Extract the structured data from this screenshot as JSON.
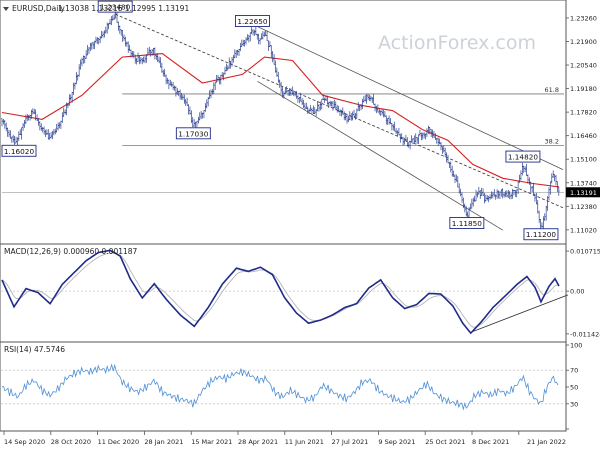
{
  "chart_data": [
    {
      "type": "candlestick",
      "title": "EURUSD,Daily",
      "ohlc_readout": "1.13038 1.13216 1.12995 1.13191",
      "watermark": "ActionForex.com",
      "y_ticks": [
        "1.23260",
        "1.21900",
        "1.20540",
        "1.19180",
        "1.17820",
        "1.16460",
        "1.15100",
        "1.13740",
        "1.12380",
        "1.11020"
      ],
      "y_tick_values": [
        1.2326,
        1.219,
        1.2054,
        1.1918,
        1.1782,
        1.1646,
        1.151,
        1.1374,
        1.1238,
        1.1102
      ],
      "ylim": [
        1.1055,
        1.2395
      ],
      "x_ticks": [
        "14 Sep 2020",
        "28 Oct 2020",
        "11 Dec 2020",
        "28 Jan 2021",
        "15 Mar 2021",
        "28 Apr 2021",
        "11 Jun 2021",
        "27 Jul 2021",
        "9 Sep 2021",
        "25 Oct 2021",
        "8 Dec 2021",
        "21 Jan 2022"
      ],
      "current_price": "1.13191",
      "current_price_value": 1.13191,
      "price_path": [
        {
          "d": 0,
          "p": 1.1745
        },
        {
          "d": 8,
          "p": 1.165
        },
        {
          "d": 14,
          "p": 1.1602
        },
        {
          "d": 22,
          "p": 1.172
        },
        {
          "d": 30,
          "p": 1.179
        },
        {
          "d": 38,
          "p": 1.17
        },
        {
          "d": 46,
          "p": 1.164
        },
        {
          "d": 54,
          "p": 1.168
        },
        {
          "d": 62,
          "p": 1.178
        },
        {
          "d": 70,
          "p": 1.19
        },
        {
          "d": 78,
          "p": 1.205
        },
        {
          "d": 86,
          "p": 1.215
        },
        {
          "d": 94,
          "p": 1.22
        },
        {
          "d": 102,
          "p": 1.225
        },
        {
          "d": 108,
          "p": 1.23
        },
        {
          "d": 113,
          "p": 1.2348
        },
        {
          "d": 118,
          "p": 1.225
        },
        {
          "d": 126,
          "p": 1.215
        },
        {
          "d": 134,
          "p": 1.209
        },
        {
          "d": 142,
          "p": 1.208
        },
        {
          "d": 150,
          "p": 1.215
        },
        {
          "d": 156,
          "p": 1.208
        },
        {
          "d": 164,
          "p": 1.196
        },
        {
          "d": 172,
          "p": 1.192
        },
        {
          "d": 180,
          "p": 1.186
        },
        {
          "d": 186,
          "p": 1.18
        },
        {
          "d": 191,
          "p": 1.1703
        },
        {
          "d": 198,
          "p": 1.176
        },
        {
          "d": 205,
          "p": 1.184
        },
        {
          "d": 213,
          "p": 1.195
        },
        {
          "d": 221,
          "p": 1.201
        },
        {
          "d": 229,
          "p": 1.208
        },
        {
          "d": 237,
          "p": 1.215
        },
        {
          "d": 244,
          "p": 1.22
        },
        {
          "d": 250,
          "p": 1.2265
        },
        {
          "d": 256,
          "p": 1.22
        },
        {
          "d": 262,
          "p": 1.223
        },
        {
          "d": 268,
          "p": 1.215
        },
        {
          "d": 274,
          "p": 1.2
        },
        {
          "d": 280,
          "p": 1.188
        },
        {
          "d": 288,
          "p": 1.19
        },
        {
          "d": 296,
          "p": 1.186
        },
        {
          "d": 304,
          "p": 1.18
        },
        {
          "d": 312,
          "p": 1.178
        },
        {
          "d": 320,
          "p": 1.185
        },
        {
          "d": 328,
          "p": 1.183
        },
        {
          "d": 336,
          "p": 1.179
        },
        {
          "d": 344,
          "p": 1.174
        },
        {
          "d": 352,
          "p": 1.177
        },
        {
          "d": 360,
          "p": 1.184
        },
        {
          "d": 366,
          "p": 1.188
        },
        {
          "d": 372,
          "p": 1.182
        },
        {
          "d": 380,
          "p": 1.176
        },
        {
          "d": 388,
          "p": 1.172
        },
        {
          "d": 396,
          "p": 1.164
        },
        {
          "d": 404,
          "p": 1.16
        },
        {
          "d": 412,
          "p": 1.162
        },
        {
          "d": 420,
          "p": 1.166
        },
        {
          "d": 426,
          "p": 1.168
        },
        {
          "d": 434,
          "p": 1.162
        },
        {
          "d": 440,
          "p": 1.156
        },
        {
          "d": 446,
          "p": 1.148
        },
        {
          "d": 452,
          "p": 1.14
        },
        {
          "d": 458,
          "p": 1.13
        },
        {
          "d": 464,
          "p": 1.1185
        },
        {
          "d": 470,
          "p": 1.126
        },
        {
          "d": 476,
          "p": 1.132
        },
        {
          "d": 482,
          "p": 1.128
        },
        {
          "d": 490,
          "p": 1.13
        },
        {
          "d": 498,
          "p": 1.132
        },
        {
          "d": 506,
          "p": 1.13
        },
        {
          "d": 514,
          "p": 1.134
        },
        {
          "d": 520,
          "p": 1.1482
        },
        {
          "d": 526,
          "p": 1.138
        },
        {
          "d": 532,
          "p": 1.13
        },
        {
          "d": 538,
          "p": 1.112
        },
        {
          "d": 542,
          "p": 1.118
        },
        {
          "d": 546,
          "p": 1.134
        },
        {
          "d": 550,
          "p": 1.142
        },
        {
          "d": 553,
          "p": 1.138
        },
        {
          "d": 556,
          "p": 1.1319
        }
      ],
      "moving_average_path": [
        {
          "d": 0,
          "p": 1.178
        },
        {
          "d": 40,
          "p": 1.174
        },
        {
          "d": 80,
          "p": 1.188
        },
        {
          "d": 120,
          "p": 1.21
        },
        {
          "d": 160,
          "p": 1.212
        },
        {
          "d": 200,
          "p": 1.195
        },
        {
          "d": 240,
          "p": 1.2
        },
        {
          "d": 262,
          "p": 1.21
        },
        {
          "d": 290,
          "p": 1.208
        },
        {
          "d": 320,
          "p": 1.188
        },
        {
          "d": 360,
          "p": 1.182
        },
        {
          "d": 390,
          "p": 1.179
        },
        {
          "d": 420,
          "p": 1.168
        },
        {
          "d": 445,
          "p": 1.162
        },
        {
          "d": 470,
          "p": 1.148
        },
        {
          "d": 500,
          "p": 1.14
        },
        {
          "d": 530,
          "p": 1.137
        },
        {
          "d": 556,
          "p": 1.135
        }
      ],
      "horizontal_lines": [
        {
          "label": "61.8",
          "price": 1.1887,
          "x_start_d": 120
        },
        {
          "label": "38.2",
          "price": 1.159,
          "x_start_d": 120
        },
        {
          "label": "",
          "price": 1.13191,
          "x_start_d": 0
        }
      ],
      "trend_lines": [
        {
          "name": "channel-upper",
          "from": {
            "d": 248,
            "p": 1.2295
          },
          "to": {
            "d": 560,
            "p": 1.145
          }
        },
        {
          "name": "channel-lower",
          "from": {
            "d": 255,
            "p": 1.196
          },
          "to": {
            "d": 500,
            "p": 1.11
          }
        },
        {
          "name": "channel-mid-dashed",
          "from": {
            "d": 113,
            "p": 1.2348
          },
          "to": {
            "d": 560,
            "p": 1.123
          }
        }
      ],
      "annotations": [
        {
          "label": "1.16020",
          "d": 14,
          "p": 1.1602,
          "anchor": "below"
        },
        {
          "label": "1.23480",
          "d": 113,
          "p": 1.2348,
          "anchor": "above"
        },
        {
          "label": "1.17030",
          "d": 191,
          "p": 1.1703,
          "anchor": "below"
        },
        {
          "label": "1.22650",
          "d": 250,
          "p": 1.2265,
          "anchor": "above"
        },
        {
          "label": "1.11850",
          "d": 464,
          "p": 1.1185,
          "anchor": "below"
        },
        {
          "label": "1.14820",
          "d": 520,
          "p": 1.1482,
          "anchor": "above"
        },
        {
          "label": "1.11200",
          "d": 538,
          "p": 1.112,
          "anchor": "below"
        }
      ]
    },
    {
      "type": "line",
      "title": "MACD(12,26,9) 0.000960 0.001187",
      "y_ticks": [
        "0.010715",
        "0.00",
        "-0.011424"
      ],
      "y_tick_values": [
        0.010715,
        0.0,
        -0.011424
      ],
      "ylim": [
        -0.0128,
        0.0118
      ],
      "series": [
        {
          "values": [
            {
              "d": 0,
              "v": 0.003
            },
            {
              "d": 12,
              "v": -0.004
            },
            {
              "d": 24,
              "v": 0.001
            },
            {
              "d": 36,
              "v": 0.0
            },
            {
              "d": 48,
              "v": -0.003
            },
            {
              "d": 60,
              "v": 0.002
            },
            {
              "d": 72,
              "v": 0.005
            },
            {
              "d": 84,
              "v": 0.008
            },
            {
              "d": 96,
              "v": 0.01
            },
            {
              "d": 108,
              "v": 0.0105
            },
            {
              "d": 118,
              "v": 0.009
            },
            {
              "d": 128,
              "v": 0.003
            },
            {
              "d": 140,
              "v": -0.002
            },
            {
              "d": 152,
              "v": 0.002
            },
            {
              "d": 164,
              "v": -0.002
            },
            {
              "d": 178,
              "v": -0.006
            },
            {
              "d": 192,
              "v": -0.009
            },
            {
              "d": 206,
              "v": -0.004
            },
            {
              "d": 220,
              "v": 0.002
            },
            {
              "d": 234,
              "v": 0.006
            },
            {
              "d": 246,
              "v": 0.005
            },
            {
              "d": 258,
              "v": 0.006
            },
            {
              "d": 270,
              "v": 0.004
            },
            {
              "d": 282,
              "v": -0.002
            },
            {
              "d": 294,
              "v": -0.006
            },
            {
              "d": 306,
              "v": -0.0085
            },
            {
              "d": 318,
              "v": -0.0075
            },
            {
              "d": 330,
              "v": -0.006
            },
            {
              "d": 342,
              "v": -0.004
            },
            {
              "d": 354,
              "v": -0.003
            },
            {
              "d": 366,
              "v": 0.001
            },
            {
              "d": 378,
              "v": 0.003
            },
            {
              "d": 390,
              "v": -0.002
            },
            {
              "d": 402,
              "v": -0.005
            },
            {
              "d": 414,
              "v": -0.004
            },
            {
              "d": 426,
              "v": -0.001
            },
            {
              "d": 438,
              "v": -0.001
            },
            {
              "d": 450,
              "v": -0.004
            },
            {
              "d": 460,
              "v": -0.0085
            },
            {
              "d": 468,
              "v": -0.011
            },
            {
              "d": 478,
              "v": -0.008
            },
            {
              "d": 490,
              "v": -0.004
            },
            {
              "d": 502,
              "v": -0.001
            },
            {
              "d": 514,
              "v": 0.002
            },
            {
              "d": 524,
              "v": 0.004
            },
            {
              "d": 532,
              "v": 0.001
            },
            {
              "d": 538,
              "v": -0.003
            },
            {
              "d": 546,
              "v": 0.001
            },
            {
              "d": 552,
              "v": 0.003
            },
            {
              "d": 556,
              "v": 0.001
            }
          ]
        }
      ],
      "trend_lines": [
        {
          "name": "macd-support-line",
          "from": {
            "d": 470,
            "v": -0.0108
          },
          "to": {
            "d": 565,
            "v": -0.001
          }
        }
      ]
    },
    {
      "type": "line",
      "title": "RSI(14) 47.5746",
      "y_ticks": [
        "100",
        "70",
        "50",
        "30",
        "0"
      ],
      "y_tick_values": [
        100,
        70,
        50,
        30,
        0
      ],
      "ylim": [
        0,
        100
      ],
      "series": [
        {
          "values": [
            {
              "d": 0,
              "v": 50
            },
            {
              "d": 8,
              "v": 44
            },
            {
              "d": 16,
              "v": 38
            },
            {
              "d": 24,
              "v": 52
            },
            {
              "d": 32,
              "v": 58
            },
            {
              "d": 40,
              "v": 46
            },
            {
              "d": 48,
              "v": 40
            },
            {
              "d": 56,
              "v": 48
            },
            {
              "d": 64,
              "v": 60
            },
            {
              "d": 72,
              "v": 66
            },
            {
              "d": 80,
              "v": 70
            },
            {
              "d": 88,
              "v": 68
            },
            {
              "d": 96,
              "v": 72
            },
            {
              "d": 104,
              "v": 70
            },
            {
              "d": 112,
              "v": 74
            },
            {
              "d": 120,
              "v": 56
            },
            {
              "d": 128,
              "v": 48
            },
            {
              "d": 136,
              "v": 44
            },
            {
              "d": 144,
              "v": 50
            },
            {
              "d": 152,
              "v": 58
            },
            {
              "d": 160,
              "v": 44
            },
            {
              "d": 168,
              "v": 40
            },
            {
              "d": 176,
              "v": 36
            },
            {
              "d": 184,
              "v": 34
            },
            {
              "d": 192,
              "v": 30
            },
            {
              "d": 200,
              "v": 46
            },
            {
              "d": 208,
              "v": 56
            },
            {
              "d": 216,
              "v": 62
            },
            {
              "d": 224,
              "v": 60
            },
            {
              "d": 232,
              "v": 66
            },
            {
              "d": 240,
              "v": 68
            },
            {
              "d": 248,
              "v": 64
            },
            {
              "d": 256,
              "v": 58
            },
            {
              "d": 264,
              "v": 60
            },
            {
              "d": 272,
              "v": 44
            },
            {
              "d": 280,
              "v": 38
            },
            {
              "d": 288,
              "v": 46
            },
            {
              "d": 296,
              "v": 40
            },
            {
              "d": 304,
              "v": 34
            },
            {
              "d": 312,
              "v": 38
            },
            {
              "d": 320,
              "v": 52
            },
            {
              "d": 328,
              "v": 46
            },
            {
              "d": 336,
              "v": 40
            },
            {
              "d": 344,
              "v": 36
            },
            {
              "d": 352,
              "v": 44
            },
            {
              "d": 360,
              "v": 56
            },
            {
              "d": 368,
              "v": 58
            },
            {
              "d": 376,
              "v": 46
            },
            {
              "d": 384,
              "v": 40
            },
            {
              "d": 392,
              "v": 36
            },
            {
              "d": 400,
              "v": 32
            },
            {
              "d": 408,
              "v": 36
            },
            {
              "d": 416,
              "v": 46
            },
            {
              "d": 424,
              "v": 54
            },
            {
              "d": 432,
              "v": 42
            },
            {
              "d": 440,
              "v": 36
            },
            {
              "d": 448,
              "v": 32
            },
            {
              "d": 456,
              "v": 30
            },
            {
              "d": 464,
              "v": 26
            },
            {
              "d": 472,
              "v": 40
            },
            {
              "d": 480,
              "v": 44
            },
            {
              "d": 488,
              "v": 40
            },
            {
              "d": 496,
              "v": 46
            },
            {
              "d": 504,
              "v": 42
            },
            {
              "d": 512,
              "v": 50
            },
            {
              "d": 520,
              "v": 62
            },
            {
              "d": 526,
              "v": 46
            },
            {
              "d": 532,
              "v": 36
            },
            {
              "d": 538,
              "v": 30
            },
            {
              "d": 544,
              "v": 50
            },
            {
              "d": 550,
              "v": 62
            },
            {
              "d": 553,
              "v": 56
            },
            {
              "d": 556,
              "v": 47.5746
            }
          ]
        }
      ]
    }
  ],
  "colors": {
    "price": "#2a3f8f",
    "moving_average": "#d72020",
    "macd_line": "#1f2a8a",
    "macd_signal": "#b5b5b5",
    "rsi_line": "#4f8fd6",
    "guide_lines": "#2b2b2b",
    "level_lines": "#7a7a7a",
    "annotation_border": "#1f2a8a",
    "watermark": "#cdd2d8",
    "axis_text": "#222222"
  }
}
